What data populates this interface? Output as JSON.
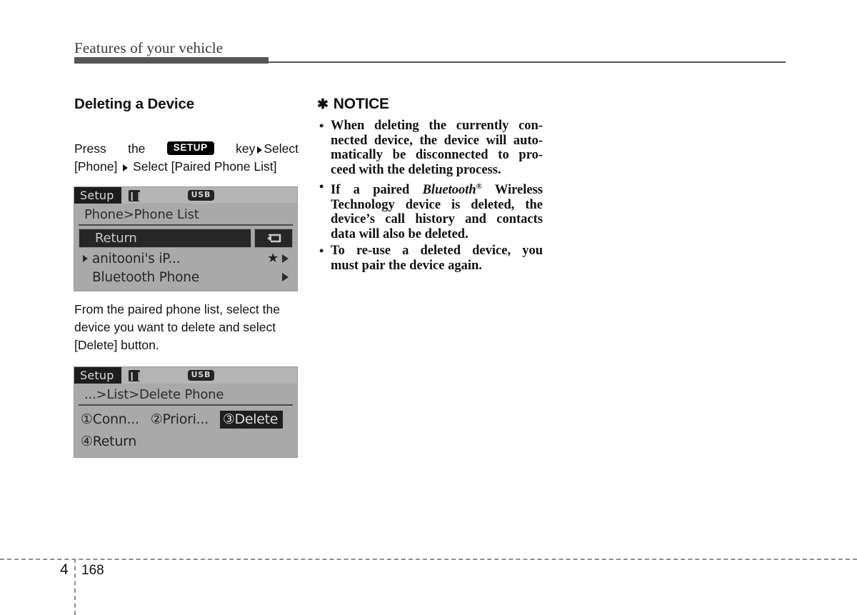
{
  "header": {
    "running_title": "Features of your vehicle"
  },
  "left_column": {
    "section_title": "Deleting a Device",
    "steps": {
      "word_press": "Press",
      "word_the": "the",
      "key_badge": "SETUP",
      "word_key": "key",
      "word_select_1": "Select",
      "line2": "[Phone]",
      "word_select_2": "Select [Paired Phone List]"
    },
    "screen1": {
      "titlebar": {
        "tab_label": "Setup",
        "bluetooth_icon": "bluetooth-icon",
        "usb_label": "USB"
      },
      "breadcrumb": "Phone>Phone List",
      "rows": [
        {
          "label": "Return",
          "type": "return",
          "button_icon": "return-arrow-icon"
        },
        {
          "label": "anitooni's iP...",
          "type": "device",
          "bullet": "triangle",
          "star": "★",
          "arrow": "triangle"
        },
        {
          "label": "Bluetooth Phone",
          "type": "device",
          "bullet": "none",
          "arrow": "triangle"
        }
      ]
    },
    "caption": {
      "line1": "From the paired phone list, select the",
      "line2": "device you want to delete and select",
      "line3": "[Delete] button."
    },
    "screen2": {
      "titlebar": {
        "tab_label": "Setup",
        "bluetooth_icon": "bluetooth-icon",
        "usb_label": "USB"
      },
      "breadcrumb": "...>List>Delete Phone",
      "menu_row1": [
        {
          "label": "①Conn...",
          "selected": false
        },
        {
          "label": "②Priori...",
          "selected": false
        },
        {
          "label": "③Delete",
          "selected": true
        }
      ],
      "menu_row2": [
        {
          "label": "④Return",
          "selected": false
        }
      ]
    }
  },
  "right_column": {
    "notice": {
      "star": "✱",
      "title": "NOTICE",
      "bullets": [
        {
          "dot": "•",
          "lines": [
            "When deleting the currently con-",
            "nected device, the device will auto-",
            "matically be disconnected to pro-",
            "ceed with the deleting process."
          ]
        },
        {
          "dot": "•",
          "lines": [
            "If a paired Bluetooth® Wireless",
            "Technology device is deleted, the",
            "device’s call history and contacts",
            "data will also be deleted."
          ],
          "rich_first_line": true,
          "rich_parts": {
            "pre": "If a paired ",
            "italic": "Bluetooth",
            "reg": "®",
            "post": " Wireless"
          }
        },
        {
          "dot": "•",
          "lines": [
            "To re-use a deleted device, you",
            "must pair the device again."
          ]
        }
      ]
    }
  },
  "footer": {
    "chapter": "4",
    "page_number": "168"
  }
}
